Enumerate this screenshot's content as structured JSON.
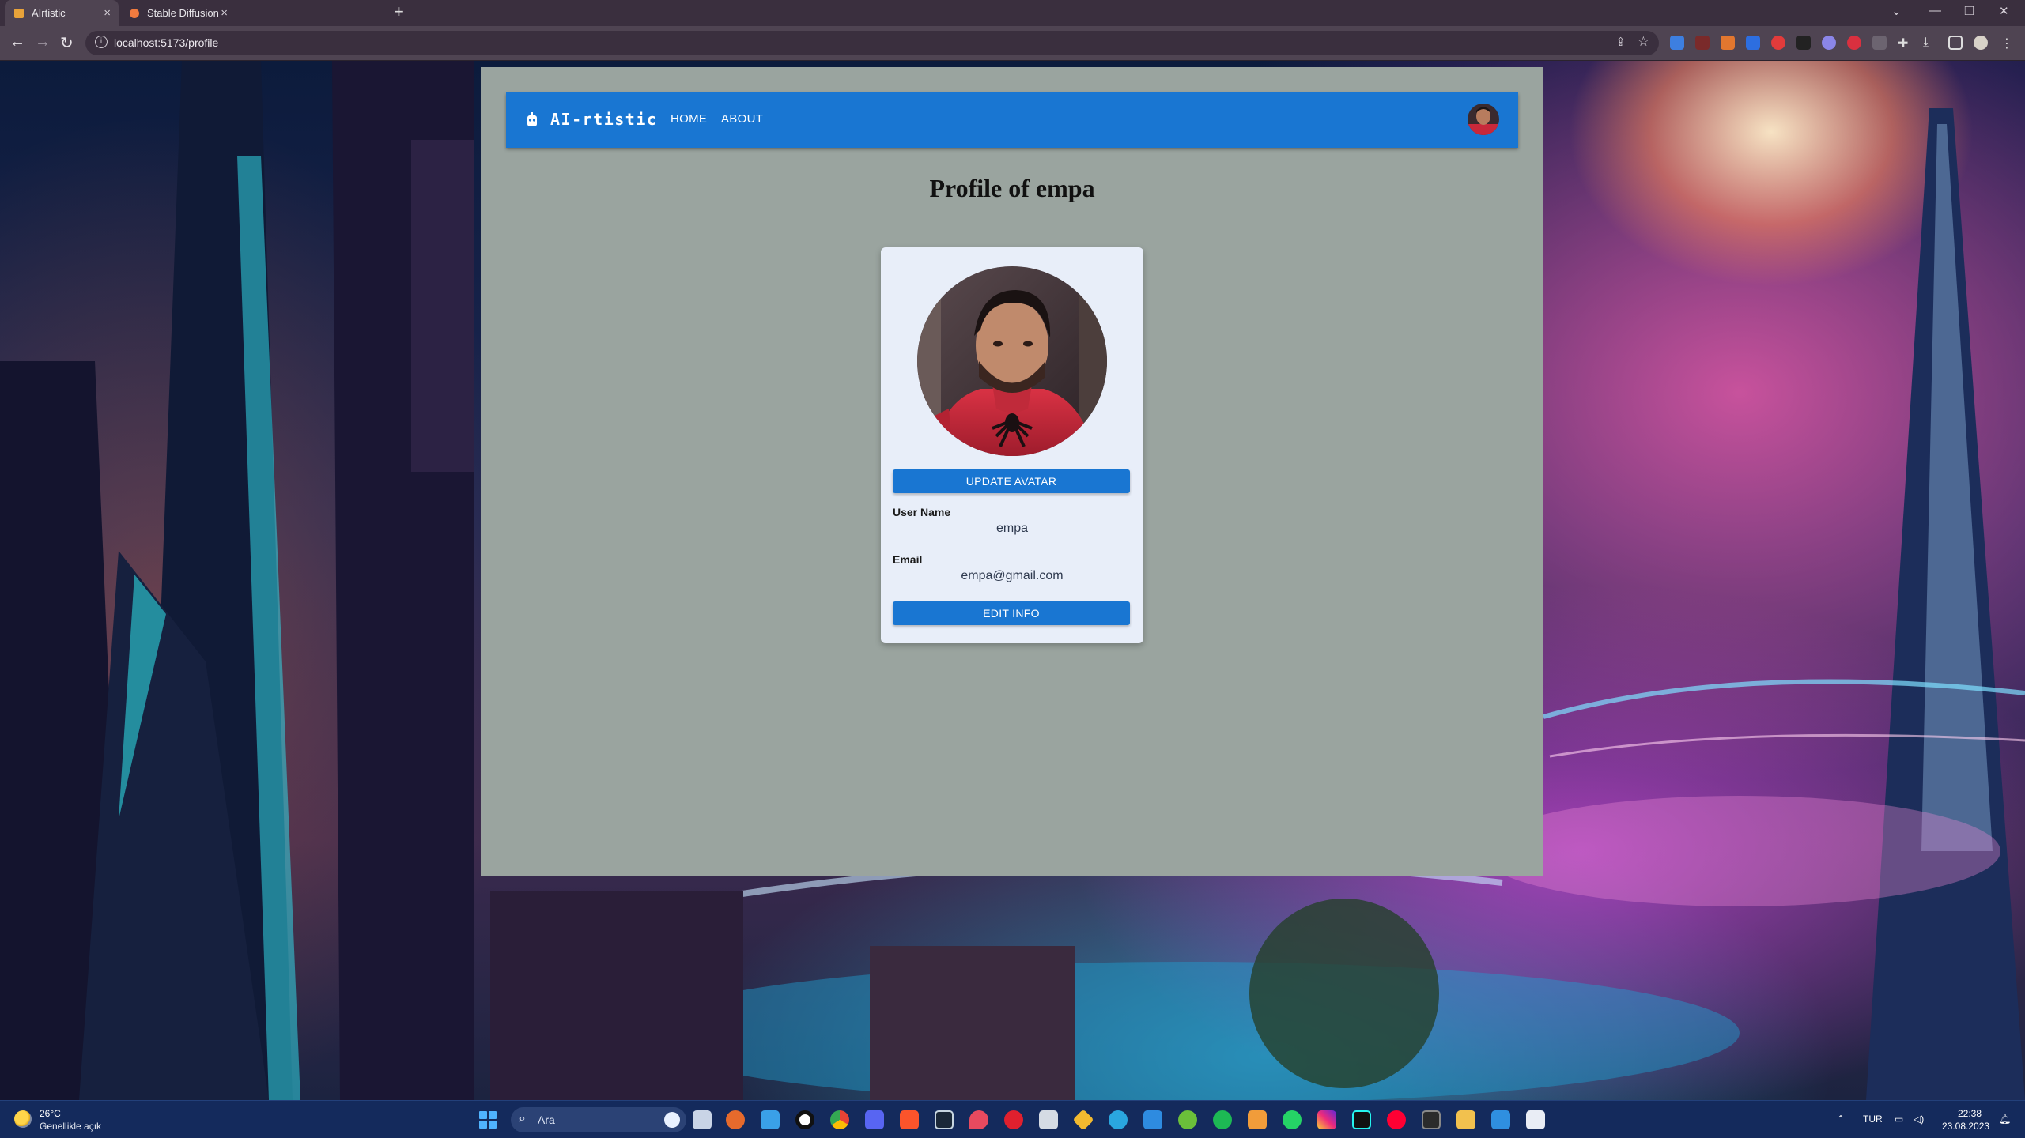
{
  "browser": {
    "tabs": [
      {
        "title": "AIrtistic",
        "active": true
      },
      {
        "title": "Stable Diffusion",
        "active": false
      }
    ],
    "new_tab_symbol": "+",
    "url": "localhost:5173/profile"
  },
  "app": {
    "brand": "AI-rtistic",
    "nav": [
      {
        "label": "HOME"
      },
      {
        "label": "ABOUT"
      }
    ],
    "accent_color": "#1976d2"
  },
  "profile": {
    "title": "Profile of empa",
    "update_avatar_label": "UPDATE AVATAR",
    "username_label": "User Name",
    "username_value": "empa",
    "email_label": "Email",
    "email_value": "empa@gmail.com",
    "edit_info_label": "EDIT INFO"
  },
  "taskbar": {
    "weather_temp": "26°C",
    "weather_desc": "Genellikle açık",
    "search_placeholder": "Ara",
    "language": "TUR",
    "time": "22:38",
    "date": "23.08.2023"
  },
  "icons": [
    "shield-icon",
    "info-icon",
    "share-icon",
    "star-icon",
    "back-icon",
    "forward-icon",
    "reload-icon",
    "search-icon",
    "windows-start-icon"
  ]
}
